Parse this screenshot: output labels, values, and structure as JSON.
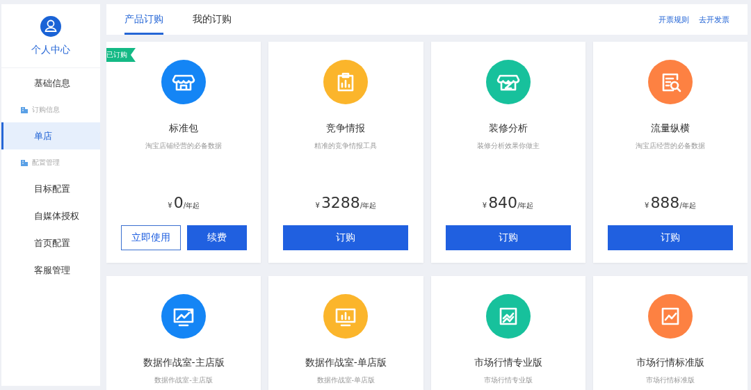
{
  "sidebar": {
    "title": "个人中心",
    "items": [
      {
        "kind": "item",
        "label": "基础信息",
        "selected": false
      },
      {
        "kind": "group",
        "label": "订购信息",
        "selected": false
      },
      {
        "kind": "item",
        "label": "单店",
        "selected": true
      },
      {
        "kind": "group",
        "label": "配置管理",
        "selected": false
      },
      {
        "kind": "item",
        "label": "目标配置",
        "selected": false
      },
      {
        "kind": "item",
        "label": "自媒体授权",
        "selected": false
      },
      {
        "kind": "item",
        "label": "首页配置",
        "selected": false
      },
      {
        "kind": "item",
        "label": "客服管理",
        "selected": false
      }
    ]
  },
  "tabs": [
    {
      "label": "产品订购",
      "selected": true
    },
    {
      "label": "我的订购",
      "selected": false
    }
  ],
  "header_links": [
    "开票规则",
    "去开发票"
  ],
  "products": [
    {
      "badge": "已订购",
      "kind": "store",
      "color": "#1485f5",
      "title": "标准包",
      "subtitle": "淘宝店铺经营的必备数据",
      "currency": "¥",
      "price": "0",
      "unit": "/年起",
      "buttons": [
        {
          "kind": "outline",
          "label": "立即使用"
        },
        {
          "kind": "primary",
          "label": "续费"
        }
      ]
    },
    {
      "kind": "clipboard",
      "color": "#fbb52b",
      "title": "竞争情报",
      "subtitle": "精准的竞争情报工具",
      "currency": "¥",
      "price": "3288",
      "unit": "/年起",
      "buttons": [
        {
          "kind": "primary",
          "label": "订购"
        }
      ]
    },
    {
      "kind": "storez",
      "color": "#17c19c",
      "title": "装修分析",
      "subtitle": "装修分析效果你做主",
      "currency": "¥",
      "price": "840",
      "unit": "/年起",
      "buttons": [
        {
          "kind": "primary",
          "label": "订购"
        }
      ]
    },
    {
      "kind": "docsearch",
      "color": "#fd8142",
      "title": "流量纵横",
      "subtitle": "淘宝店经营的必备数据",
      "currency": "¥",
      "price": "888",
      "unit": "/年起",
      "buttons": [
        {
          "kind": "primary",
          "label": "订购"
        }
      ]
    },
    {
      "kind": "monitortrend",
      "color": "#1485f5",
      "title": "数据作战室-主店版",
      "subtitle": "数据作战室-主店版"
    },
    {
      "kind": "monitorbars",
      "color": "#fbb52b",
      "title": "数据作战室-单店版",
      "subtitle": "数据作战室-单店版"
    },
    {
      "kind": "boxtrend",
      "color": "#17c19c",
      "title": "市场行情专业版",
      "subtitle": "市场行情专业版"
    },
    {
      "kind": "boxline",
      "color": "#fd8142",
      "title": "市场行情标准版",
      "subtitle": "市场行情标准版"
    }
  ]
}
